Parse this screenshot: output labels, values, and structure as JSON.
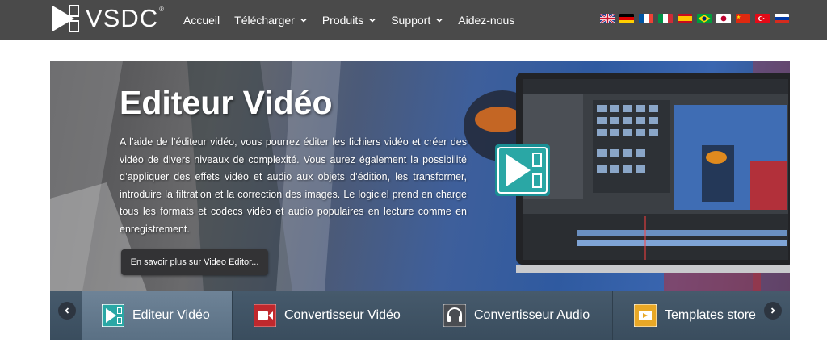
{
  "brand": {
    "name": "VSDC",
    "reg": "®"
  },
  "nav": [
    {
      "label": "Accueil",
      "has_dropdown": false
    },
    {
      "label": "Télécharger",
      "has_dropdown": true
    },
    {
      "label": "Produits",
      "has_dropdown": true
    },
    {
      "label": "Support",
      "has_dropdown": true
    },
    {
      "label": "Aidez-nous",
      "has_dropdown": false
    }
  ],
  "languages": [
    "uk-flag-icon",
    "de-flag-icon",
    "fr-flag-icon",
    "it-flag-icon",
    "es-flag-icon",
    "br-flag-icon",
    "jp-flag-icon",
    "cn-flag-icon",
    "tr-flag-icon",
    "ru-flag-icon"
  ],
  "hero": {
    "title": "Editeur Vidéo",
    "description": "A l’aide de l’éditeur vidéo, vous pourrez éditer les fichiers vidéo et créer des vidéo de divers niveaux de complexité. Vous aurez également la possibilité d’appliquer des effets vidéo et audio aux objets d’édition, les transformer, introduire la filtration et la correction des images. Le logiciel prend en charge tous les formats et codecs vidéo et audio populaires en lecture comme en enregistrement.",
    "button_label": "En savoir plus sur Video Editor..."
  },
  "tabs": [
    {
      "label": "Editeur Vidéo",
      "icon": "video-editor-icon",
      "active": true
    },
    {
      "label": "Convertisseur Vidéo",
      "icon": "video-converter-icon",
      "active": false
    },
    {
      "label": "Convertisseur Audio",
      "icon": "audio-converter-icon",
      "active": false
    },
    {
      "label": "Templates store",
      "icon": "templates-store-icon",
      "active": false
    }
  ],
  "colors": {
    "topbar": "#4a4a4a",
    "tabs_bg": "#3f5264",
    "accent_teal": "#2aa7a5"
  }
}
